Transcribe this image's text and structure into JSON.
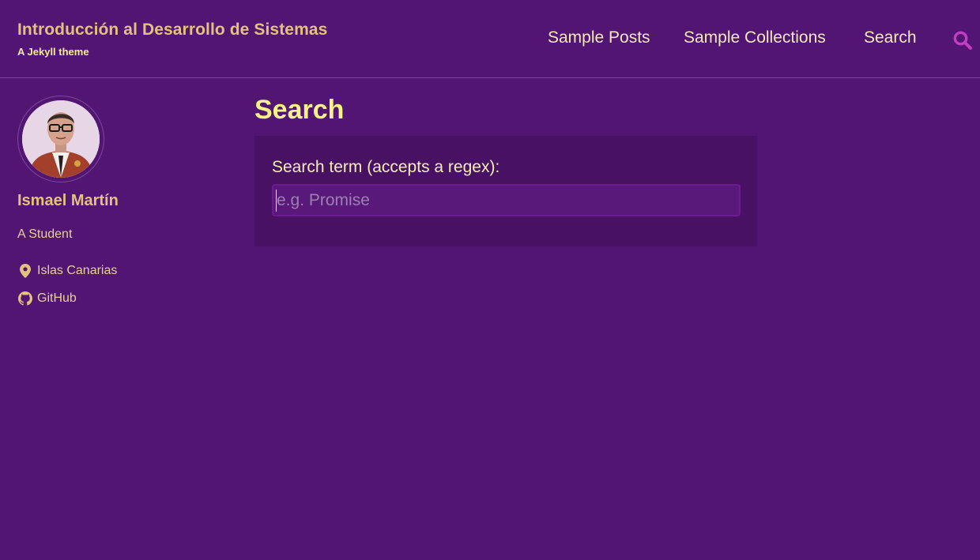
{
  "site": {
    "title": "Introducción al Desarrollo de Sistemas",
    "subtitle": "A Jekyll theme"
  },
  "nav": {
    "items": [
      {
        "label": "Sample Posts"
      },
      {
        "label": "Sample Collections"
      },
      {
        "label": "Search"
      }
    ],
    "search_icon": "search-icon"
  },
  "author": {
    "name": "Ismael Martín",
    "bio": "A Student",
    "links": [
      {
        "icon": "map-marker-icon",
        "label": "Islas Canarias"
      },
      {
        "icon": "github-icon",
        "label": "GitHub"
      }
    ]
  },
  "page": {
    "title": "Search"
  },
  "search": {
    "label": "Search term (accepts a regex):",
    "placeholder": "e.g. Promise",
    "value": ""
  },
  "colors": {
    "background": "#521574",
    "title_accent": "#e2c37c",
    "heading_accent": "#f6f28a",
    "search_icon": "#c53cc4"
  }
}
